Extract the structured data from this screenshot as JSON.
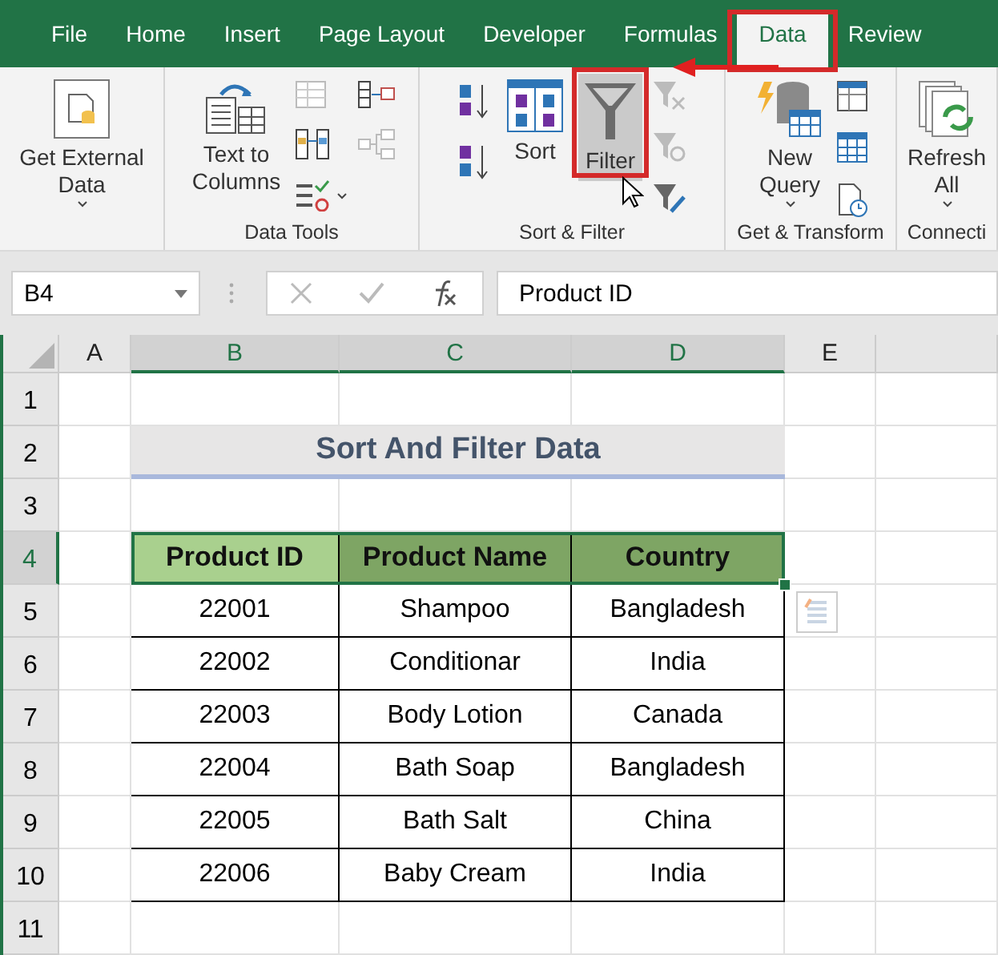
{
  "tabs": [
    {
      "label": "File",
      "selected": false
    },
    {
      "label": "Home",
      "selected": false
    },
    {
      "label": "Insert",
      "selected": false
    },
    {
      "label": "Page Layout",
      "selected": false
    },
    {
      "label": "Developer",
      "selected": false
    },
    {
      "label": "Formulas",
      "selected": false
    },
    {
      "label": "Data",
      "selected": true
    },
    {
      "label": "Review",
      "selected": false
    }
  ],
  "ribbon": {
    "groups": [
      {
        "buttons": [
          {
            "label": "Get External Data",
            "dropdown": true,
            "active": false
          }
        ]
      },
      {
        "label": "Data Tools",
        "buttons": [
          {
            "label": "Text to Columns",
            "dropdown": false,
            "active": false
          }
        ]
      },
      {
        "label": "Sort & Filter",
        "buttons": [
          {
            "label": "Sort",
            "dropdown": false,
            "active": false
          },
          {
            "label": "Filter",
            "dropdown": false,
            "active": true
          }
        ]
      },
      {
        "label": "Get & Transform",
        "buttons": [
          {
            "label": "New Query",
            "dropdown": true,
            "active": false
          }
        ]
      },
      {
        "label": "Connecti",
        "buttons": [
          {
            "label": "Refresh All",
            "dropdown": true,
            "active": false
          }
        ]
      }
    ]
  },
  "formula_bar": {
    "name_box": "B4",
    "content": "Product ID"
  },
  "sheet": {
    "columns": [
      {
        "label": "A",
        "selected": false
      },
      {
        "label": "B",
        "selected": true
      },
      {
        "label": "C",
        "selected": true
      },
      {
        "label": "D",
        "selected": true
      },
      {
        "label": "E",
        "selected": false
      }
    ],
    "rows": [
      {
        "label": "1",
        "selected": false
      },
      {
        "label": "2",
        "selected": false
      },
      {
        "label": "3",
        "selected": false
      },
      {
        "label": "4",
        "selected": true
      },
      {
        "label": "5",
        "selected": false
      },
      {
        "label": "6",
        "selected": false
      },
      {
        "label": "7",
        "selected": false
      },
      {
        "label": "8",
        "selected": false
      },
      {
        "label": "9",
        "selected": false
      },
      {
        "label": "10",
        "selected": false
      },
      {
        "label": "11",
        "selected": false
      }
    ],
    "title": "Sort And Filter Data",
    "table": {
      "headers": [
        {
          "label": "Product ID",
          "color": "#a9d08e"
        },
        {
          "label": "Product Name",
          "color": "#7ea564"
        },
        {
          "label": "Country",
          "color": "#7ea564"
        }
      ],
      "rows": [
        [
          "22001",
          "Shampoo",
          "Bangladesh"
        ],
        [
          "22002",
          "Conditionar",
          "India"
        ],
        [
          "22003",
          "Body Lotion",
          "Canada"
        ],
        [
          "22004",
          "Bath Soap",
          "Bangladesh"
        ],
        [
          "22005",
          "Bath Salt",
          "China"
        ],
        [
          "22006",
          "Baby Cream",
          "India"
        ]
      ]
    }
  }
}
